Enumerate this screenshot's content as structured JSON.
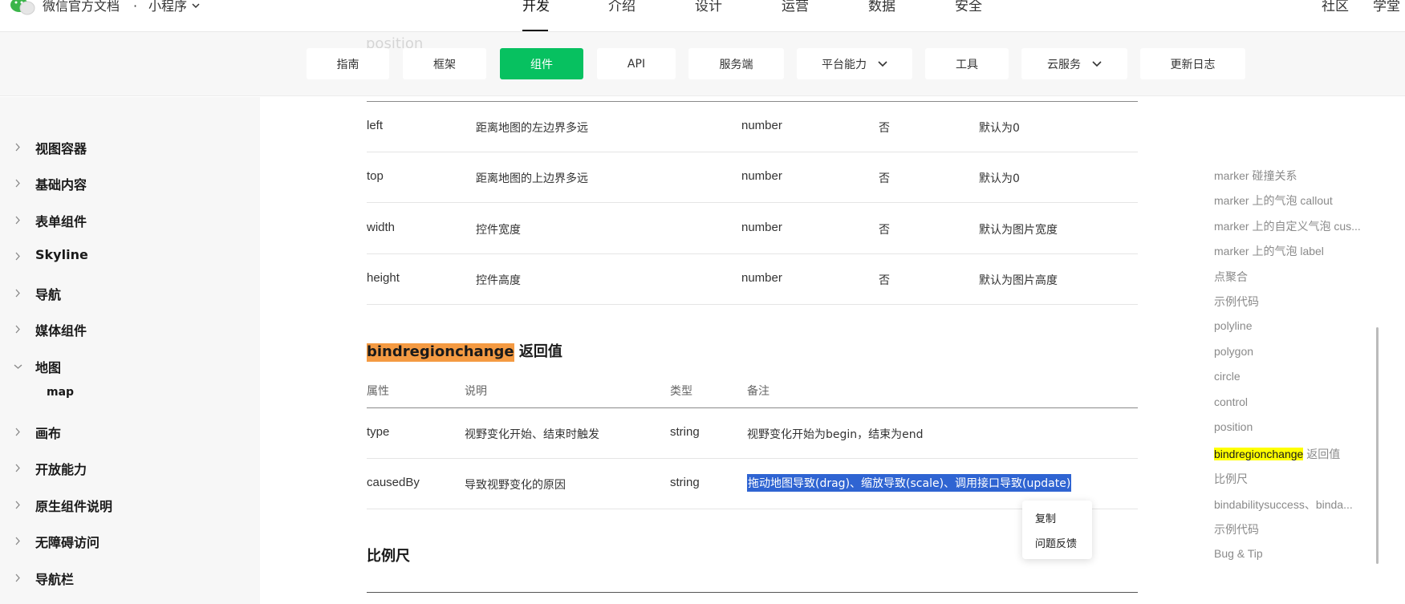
{
  "topbar": {
    "brand": "微信官方文档",
    "dot": "·",
    "product": "小程序",
    "nav": [
      "开发",
      "介绍",
      "设计",
      "运营",
      "数据",
      "安全"
    ],
    "right": [
      "社区",
      "学堂"
    ]
  },
  "subnav": {
    "items": [
      "指南",
      "框架",
      "组件",
      "API",
      "服务端",
      "平台能力",
      "工具",
      "云服务",
      "更新日志"
    ],
    "active": "组件",
    "ghost": "position"
  },
  "sidebar": {
    "items": [
      "视图容器",
      "基础内容",
      "表单组件",
      "Skyline",
      "导航",
      "媒体组件",
      "地图",
      "画布",
      "开放能力",
      "原生组件说明",
      "无障碍访问",
      "导航栏"
    ],
    "expanded": "地图",
    "sub_item": "map"
  },
  "table1": {
    "rows": [
      [
        "left",
        "距离地图的左边界多远",
        "number",
        "否",
        "默认为0"
      ],
      [
        "top",
        "距离地图的上边界多远",
        "number",
        "否",
        "默认为0"
      ],
      [
        "width",
        "控件宽度",
        "number",
        "否",
        "默认为图片宽度"
      ],
      [
        "height",
        "控件高度",
        "number",
        "否",
        "默认为图片高度"
      ]
    ]
  },
  "section": {
    "title_highlight": "bindregionchange",
    "title_rest": " 返回值",
    "next_title": "比例尺"
  },
  "table2": {
    "headers": [
      "属性",
      "说明",
      "类型",
      "备注"
    ],
    "rows": [
      [
        "type",
        "视野变化开始、结束时触发",
        "string",
        "视野变化开始为begin，结束为end"
      ],
      [
        "causedBy",
        "导致视野变化的原因",
        "string",
        "拖动地图导致(drag)、缩放导致(scale)、调用接口导致(update)"
      ]
    ]
  },
  "context_menu": {
    "items": [
      "复制",
      "问题反馈"
    ]
  },
  "toc": {
    "items": [
      "marker 碰撞关系",
      "marker 上的气泡 callout",
      "marker 上的自定义气泡 cus...",
      "marker 上的气泡 label",
      "点聚合",
      "示例代码",
      "polyline",
      "polygon",
      "circle",
      "control",
      "position"
    ],
    "active_highlight": "bindregionchange",
    "active_rest": " 返回值",
    "after": [
      "比例尺",
      "bindabilitysuccess、binda...",
      "示例代码",
      "Bug & Tip"
    ]
  },
  "colors": {
    "brand_green": "#07c160",
    "selection_blue": "#2f64d2",
    "highlight_orange": "#f49a42",
    "highlight_yellow": "#ffff00"
  }
}
